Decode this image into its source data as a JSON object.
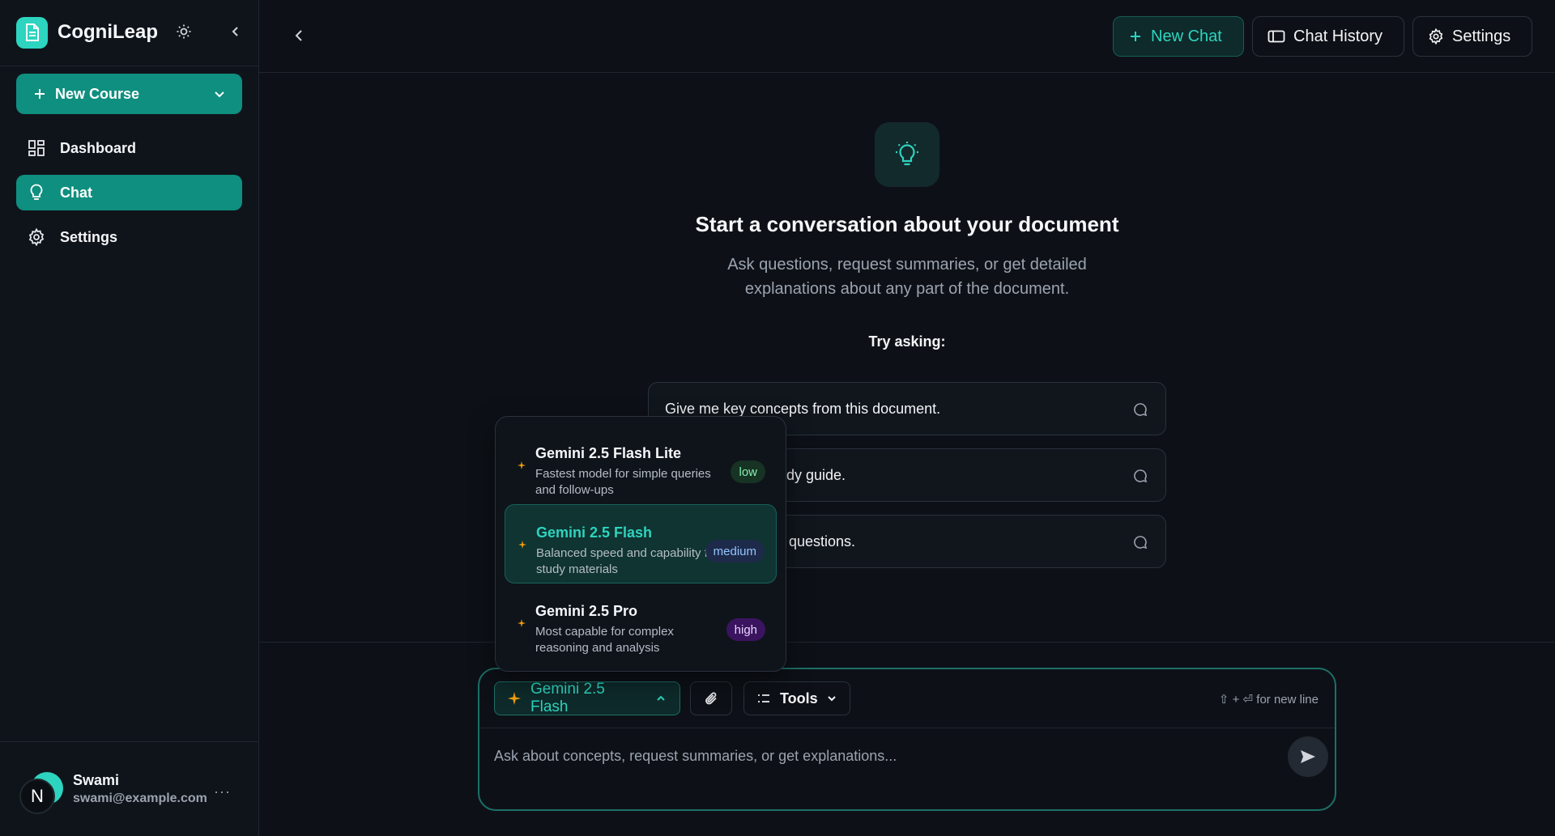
{
  "app": {
    "name": "CogniLeap"
  },
  "sidebar": {
    "new_course_label": "New Course",
    "nav": [
      {
        "label": "Dashboard",
        "icon": "dashboard-icon",
        "active": false
      },
      {
        "label": "Chat",
        "icon": "lightbulb-icon",
        "active": true
      },
      {
        "label": "Settings",
        "icon": "gear-icon",
        "active": false
      }
    ],
    "user": {
      "initial": "N",
      "name": "Swami",
      "email": "swami@example.com",
      "more": "···"
    }
  },
  "header": {
    "new_chat_label": "New Chat",
    "history_label": "Chat History",
    "settings_label": "Settings"
  },
  "empty_state": {
    "title": "Start a conversation about your document",
    "subtitle": "Ask questions, request summaries, or get detailed explanations about any part of the document.",
    "try_label": "Try asking:",
    "suggestions": [
      "Give me key concepts from this document.",
      "dy guide.",
      "questions."
    ]
  },
  "model_menu": {
    "options": [
      {
        "name": "Gemini 2.5 Flash Lite",
        "desc": "Fastest model for simple queries and follow-ups",
        "badge": "low",
        "selected": false
      },
      {
        "name": "Gemini 2.5 Flash",
        "desc": "Balanced speed and capability for study materials",
        "badge": "medium",
        "selected": true
      },
      {
        "name": "Gemini 2.5 Pro",
        "desc": "Most capable for complex reasoning and analysis",
        "badge": "high",
        "selected": false
      }
    ]
  },
  "composer": {
    "model_label": "Gemini 2.5 Flash",
    "tools_label": "Tools",
    "newline_hint": "⇧ + ⏎ for new line",
    "placeholder": "Ask about concepts, request summaries, or get explanations..."
  },
  "colors": {
    "accent": "#2dd4bf",
    "accent_dark": "#0f8f7f",
    "background": "#0d1117",
    "sidebar": "#0f141b"
  }
}
